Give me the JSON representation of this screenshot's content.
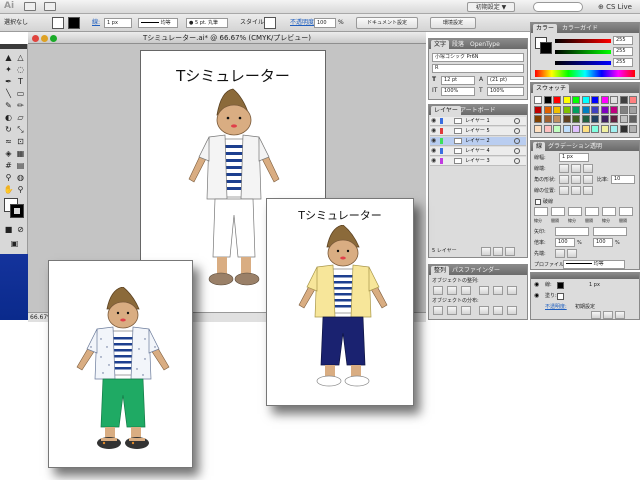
{
  "menubar": {
    "app_logo": "Ai",
    "workspace": "初期設定 ▼",
    "cs_live": "CS Live"
  },
  "controlbar": {
    "selection_label": "選択なし",
    "stroke_label": "線:",
    "stroke_weight": "1 px",
    "profile_label": "均等",
    "brush_label": "5 pt. 丸筆",
    "style_label": "スタイル:",
    "opacity_label": "不透明度:",
    "opacity_value": "100",
    "opacity_unit": "%",
    "doc_setup": "ドキュメント設定",
    "preferences": "環境設定"
  },
  "document": {
    "title": "Tシミュレーター.ai* @ 66.67% (CMYK/プレビュー)",
    "artboard_title": "Tシミュレーター",
    "zoom": "66.67%"
  },
  "page_right": {
    "title": "Tシミュレーター"
  },
  "character_panel": {
    "tabs": [
      "文字",
      "段落",
      "OpenType"
    ],
    "font_family": "小塚ゴシック Pr6N",
    "font_style": "R",
    "size": "12 pt",
    "leading": "(21 pt)",
    "hscale": "100%",
    "vscale": "100%"
  },
  "layers_panel": {
    "tabs": [
      "レイヤー",
      "アートボード"
    ],
    "layers": [
      {
        "name": "レイヤー 1",
        "color": "#3b6fe0"
      },
      {
        "name": "レイヤー 5",
        "color": "#e03b3b"
      },
      {
        "name": "レイヤー 2",
        "color": "#3be05a"
      },
      {
        "name": "レイヤー 4",
        "color": "#3b6fe0"
      },
      {
        "name": "レイヤー 3",
        "color": "#c03be0"
      }
    ],
    "footer": "5 レイヤー"
  },
  "align_panel": {
    "tabs": [
      "整列",
      "パスファインダー"
    ],
    "section1": "オブジェクトの整列:",
    "section2": "オブジェクトの分布:",
    "section3": "等間隔に分布:"
  },
  "color_panel": {
    "tabs": [
      "カラー",
      "カラーガイド"
    ],
    "values": [
      "255",
      "255",
      "255"
    ]
  },
  "swatches_panel": {
    "tabs": [
      "スウォッチ"
    ]
  },
  "stroke_panel": {
    "tabs": [
      "線",
      "グラデーション",
      "透明"
    ],
    "weight_label": "線幅:",
    "weight": "1 px",
    "cap_label": "線端:",
    "corner_label": "角の形状:",
    "limit_label": "比率:",
    "limit": "10",
    "align_label": "線の位置:",
    "dashed_label": "破線",
    "dash_labels": [
      "線分",
      "間隔",
      "線分",
      "間隔",
      "線分",
      "間隔"
    ],
    "arrow_label": "矢印:",
    "scale_label": "倍率:",
    "scale_values": [
      "100",
      "%",
      "100",
      "%"
    ],
    "align_arrow_label": "先端:",
    "profile_label": "プロファイル:",
    "profile_value": "均等"
  },
  "appearance_panel": {
    "rows": [
      {
        "label": "線:",
        "value": "1 px"
      },
      {
        "label": "塗り:",
        "value": ""
      }
    ],
    "opacity": "不透明度:",
    "opacity_value": "初期設定"
  }
}
